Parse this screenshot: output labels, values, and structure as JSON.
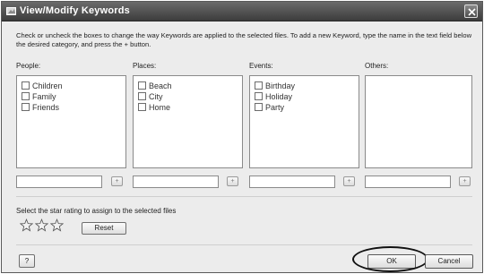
{
  "window": {
    "title": "View/Modify Keywords"
  },
  "instructions": "Check or uncheck the boxes to change the way Keywords are applied to the selected files. To add a new Keyword, type the name in the text field below the desired category, and press the + button.",
  "categories": [
    {
      "label": "People:",
      "items": [
        "Children",
        "Family",
        "Friends"
      ],
      "input_value": "",
      "add_label": "+"
    },
    {
      "label": "Places:",
      "items": [
        "Beach",
        "City",
        "Home"
      ],
      "input_value": "",
      "add_label": "+"
    },
    {
      "label": "Events:",
      "items": [
        "Birthday",
        "Holiday",
        "Party"
      ],
      "input_value": "",
      "add_label": "+"
    },
    {
      "label": "Others:",
      "items": [],
      "input_value": "",
      "add_label": "+"
    }
  ],
  "rating": {
    "label": "Select the star rating to assign to the selected files",
    "stars": [
      "star-icon",
      "star-icon",
      "star-icon"
    ],
    "reset_label": "Reset"
  },
  "buttons": {
    "help_label": "?",
    "ok_label": "OK",
    "cancel_label": "Cancel"
  },
  "colors": {
    "titlebar": "#4a4a4a",
    "highlight_ring": "#111111"
  }
}
